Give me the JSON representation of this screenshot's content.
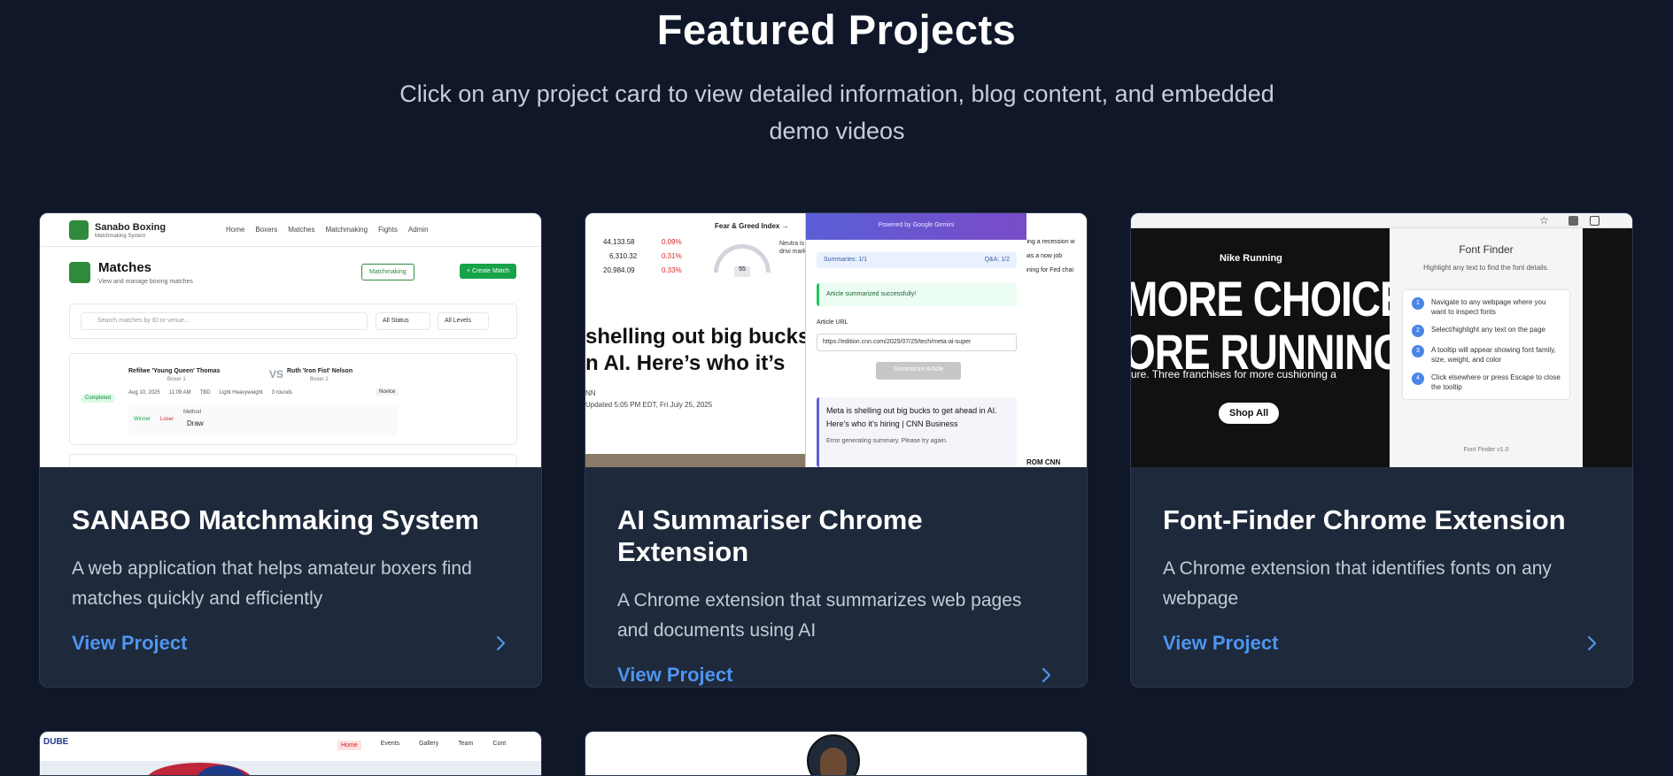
{
  "header": {
    "title": "Featured Projects",
    "subtitle": "Click on any project card to view detailed information, blog content, and embedded demo videos"
  },
  "projects": [
    {
      "title": "SANABO Matchmaking System",
      "description": "A web application that helps amateur boxers find matches quickly and efficiently",
      "link": "View Project"
    },
    {
      "title": "AI Summariser Chrome Extension",
      "description": "A Chrome extension that summarizes web pages and documents using AI",
      "link": "View Project"
    },
    {
      "title": "Font-Finder Chrome Extension",
      "description": "A Chrome extension that identifies fonts on any webpage",
      "link": "View Project"
    }
  ],
  "shot_sanabo": {
    "brand": "Sanabo Boxing",
    "brand_sub": "Matchmaking System",
    "nav": [
      "Home",
      "Boxers",
      "Matches",
      "Matchmaking",
      "Fights",
      "Admin"
    ],
    "heading": "Matches",
    "heading_sub": "View and manage boxing matches",
    "btn_matchmaking": "Matchmaking",
    "btn_create": "+ Create Match",
    "search_placeholder": "Search matches by ID or venue...",
    "filter_status": "All Status",
    "filter_levels": "All Levels",
    "fighter1": "Refilwe 'Young Queen' Thomas",
    "fighter1_role": "Boxer 1",
    "vs": "VS",
    "fighter2": "Ruth 'Iron Fist' Nelson",
    "fighter2_role": "Boxer 2",
    "status": "Completed",
    "meta": [
      "Aug 10, 2025",
      "11:09 AM",
      "TBD",
      "Light Heavyweight",
      "3 rounds"
    ],
    "level": "Novice",
    "winner": "Winner",
    "loser": "Loser",
    "method_label": "Method",
    "method": "Draw"
  },
  "shot_summariser": {
    "tickers": [
      "44,133.58",
      "6,310.32",
      "20,984.09"
    ],
    "changes": [
      "0.09%",
      "0.31%",
      "0.33%"
    ],
    "fear_greed": "Fear & Greed Index →",
    "gauge_value": "55",
    "neutral_text": "Neutra is drivi market",
    "headline_1": "shelling out big bucks",
    "headline_2": "n AI. Here’s who it’s",
    "byline_1": "NN",
    "byline_2": "Updated 5:05 PM EDT, Fri July 25, 2025",
    "right_text": [
      "sing a recession w",
      "has a now job",
      "nning for Fed chai"
    ],
    "powered_by": "Powered by Google Gemini",
    "summaries": "Summaries: 1/1",
    "qa": "Q&A: 1/2",
    "success": "Article summarized successfully!",
    "url_label": "Article URL",
    "url_value": "https://edition.cnn.com/2025/07/25/tech/meta-ai-super",
    "summarize_btn": "Summarize Article",
    "result_title": "Meta is shelling out big bucks to get ahead in AI. Here’s who it’s hiring | CNN Business",
    "result_error": "Error generating summary. Please try again.",
    "from_cnn": "ROM CNN"
  },
  "shot_fontfinder": {
    "nike_title": "Nike Running",
    "big_line1": "MORE CHOICE.",
    "big_line2": "ORE RUNNING",
    "tagline": "ure. Three franchises for more cushioning a",
    "shop_all": "Shop All",
    "panel_title": "Font Finder",
    "panel_sub": "Highlight any text to find the font details.",
    "steps": [
      {
        "n": "1",
        "text": "Navigate to any webpage where you want to inspect fonts"
      },
      {
        "n": "2",
        "text": "Select/highlight any text on the page"
      },
      {
        "n": "3",
        "text": "A tooltip will appear showing font family, size, weight, and color"
      },
      {
        "n": "4",
        "text": "Click elsewhere or press Escape to close the tooltip"
      }
    ],
    "version": "Font Finder v1.0"
  },
  "shot_dube": {
    "logo": "DUBE",
    "nav": [
      "Home",
      "Events",
      "Gallery",
      "Team",
      "Cont"
    ]
  },
  "colors": {
    "background": "#0f1729",
    "card": "#1e293b",
    "link": "#4e95f0"
  }
}
